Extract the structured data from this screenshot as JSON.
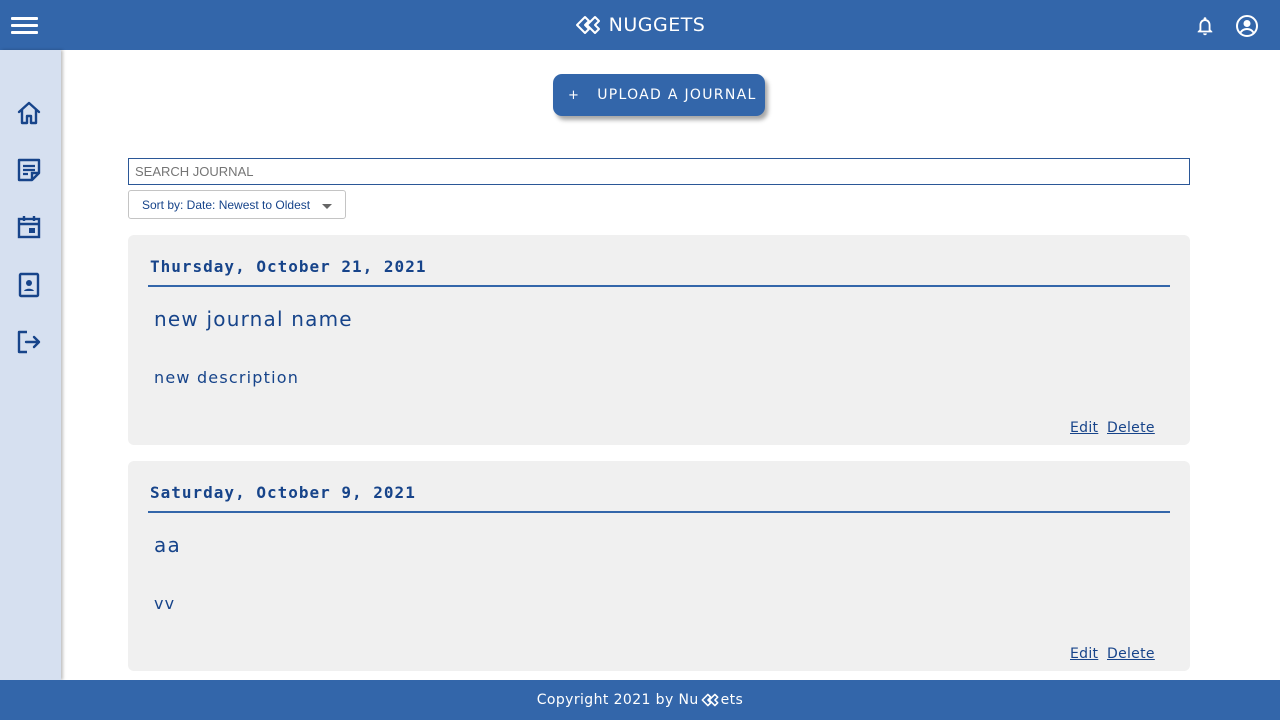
{
  "header": {
    "brand": "NUGGETS",
    "icons": [
      "menu-icon",
      "nuggets-logo-icon",
      "bell-icon",
      "account-circle-icon"
    ]
  },
  "sidebar": {
    "items": [
      {
        "icon": "home-icon"
      },
      {
        "icon": "journal-note-icon"
      },
      {
        "icon": "calendar-icon"
      },
      {
        "icon": "contact-card-icon"
      },
      {
        "icon": "logout-icon"
      }
    ]
  },
  "actions": {
    "upload_plus": "+",
    "upload_label": "UPLOAD A JOURNAL"
  },
  "search": {
    "placeholder": "SEARCH JOURNAL",
    "value": ""
  },
  "sort": {
    "selected": "Sort by: Date: Newest to Oldest"
  },
  "journals": [
    {
      "date": "Thursday, October 21, 2021",
      "title": "new journal name",
      "description": "new description",
      "edit_label": "Edit",
      "delete_label": "Delete"
    },
    {
      "date": "Saturday, October 9, 2021",
      "title": "aa",
      "description": "vv",
      "edit_label": "Edit",
      "delete_label": "Delete"
    }
  ],
  "footer": {
    "prefix": "Copyright 2021 by Nu",
    "suffix": "ets"
  },
  "colors": {
    "primary": "#3366aa",
    "text": "#17448a",
    "sidebar_bg": "#d6e0f0",
    "card_bg": "#f0f0f0"
  }
}
